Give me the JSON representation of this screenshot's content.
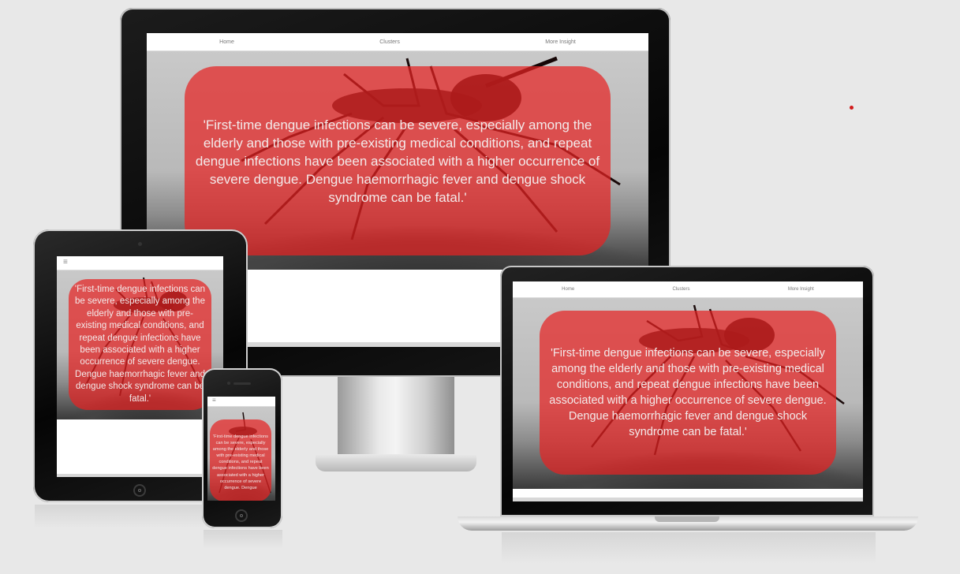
{
  "nav": {
    "home": "Home",
    "clusters": "Clusters",
    "insight": "More Insight"
  },
  "quote": "'First-time dengue infections can be severe, especially among the elderly and those with pre-existing medical conditions, and repeat dengue infections have been associated with a higher occurrence of severe dengue. Dengue haemorrhagic fever and dengue shock syndrome can be fatal.'",
  "phone_quote": "'First-time dengue infections can be severe, especially among the elderly and those with pre-existing medical conditions, and repeat dengue infections have been associated with a higher occurrence of severe dengue. Dengue",
  "menu_icon_glyph": "≡",
  "colors": {
    "overlay": "#e62323",
    "page_bg": "#e8e8e8",
    "accent_dot": "#d11b1b"
  },
  "icons": [
    "menu-icon",
    "home-button-icon",
    "camera-icon"
  ]
}
